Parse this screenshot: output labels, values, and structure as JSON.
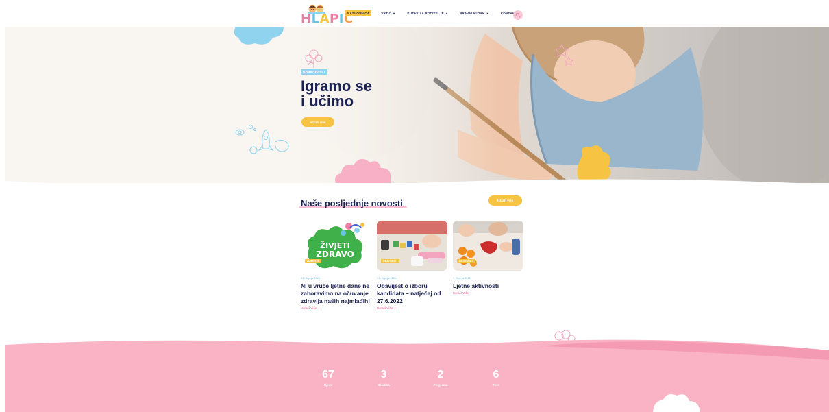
{
  "brand": {
    "logo_text": "HLAPIĆ",
    "colors": {
      "navy": "#1b2150",
      "yellow": "#f6c442",
      "pink": "#f9b3c5",
      "blue": "#8fd3ee"
    }
  },
  "nav": {
    "items": [
      {
        "label": "NASLOVNICA",
        "active": true,
        "dropdown": false
      },
      {
        "label": "VRTIĆ",
        "active": false,
        "dropdown": true
      },
      {
        "label": "KUTAK ZA RODITELJE",
        "active": false,
        "dropdown": true
      },
      {
        "label": "PRAVNI KUTAK",
        "active": false,
        "dropdown": true
      },
      {
        "label": "KONTAKT",
        "active": false,
        "dropdown": false
      }
    ],
    "search_icon": "search-icon"
  },
  "hero": {
    "badge": "DOBRODOŠLI",
    "title_line1": "Igramo se",
    "title_line2": "i učimo",
    "button": "Istraži više"
  },
  "news": {
    "title": "Naše posljednje novosti",
    "more_button": "Istraži više",
    "cards": [
      {
        "tag": "ZDRAVLJE",
        "date": "21. Srpnja 2022.",
        "title": "Ni u vruće ljetne dane ne zaboravimo na očuvanje zdravlja naših najmlađih!",
        "more": "Istraži Više",
        "image_text_line1": "ŽIVJETI",
        "image_text_line2": "ZDRAVO"
      },
      {
        "tag": "OBAVIJESTI",
        "date": "21. Srpnja 2022.",
        "title": "Obavijest o izboru kandidata – natječaj od 27.6.2022",
        "more": "Istraži Više"
      },
      {
        "tag": "AKTIVNOSTI",
        "date": "7. Srpnja 2022.",
        "title": "Ljetne aktivnosti",
        "more": "Istraži Više"
      }
    ]
  },
  "stats": [
    {
      "value": "67",
      "label": "Djece"
    },
    {
      "value": "3",
      "label": "Skupina"
    },
    {
      "value": "2",
      "label": "Programa"
    },
    {
      "value": "6",
      "label": "Tete"
    }
  ]
}
